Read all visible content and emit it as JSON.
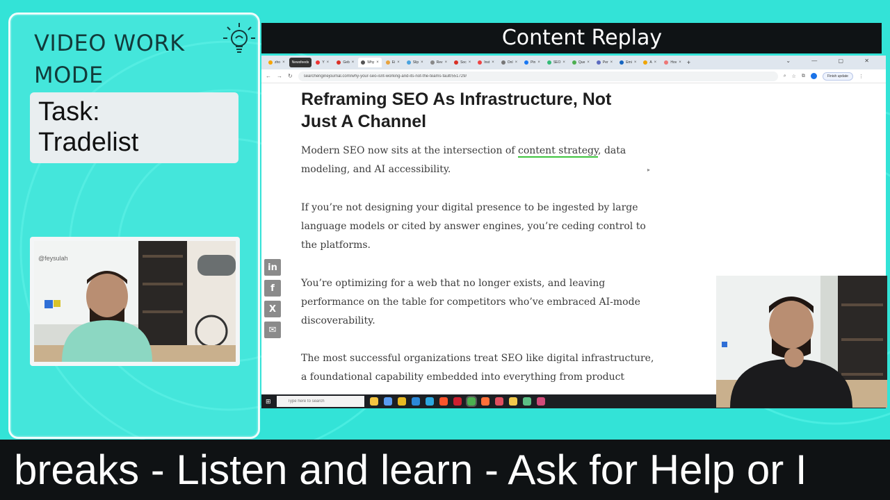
{
  "overlay": {
    "mode_title": "VIDEO WORK MODE",
    "task_label": "Task:",
    "task_value": "Tradelist",
    "header_title": "Content Replay",
    "ticker_text": "breaks - Listen and learn - Ask for Help or I"
  },
  "browser": {
    "tabs": [
      {
        "label": "zho",
        "active": false
      },
      {
        "label": "Newsfeeds",
        "active": false,
        "badge": true
      },
      {
        "label": "Y",
        "active": false
      },
      {
        "label": "Geb",
        "active": false
      },
      {
        "label": "Why",
        "active": true
      },
      {
        "label": "Ei",
        "active": false
      },
      {
        "label": "Slip",
        "active": false
      },
      {
        "label": "Rev",
        "active": false
      },
      {
        "label": "Soc",
        "active": false
      },
      {
        "label": "Inst",
        "active": false
      },
      {
        "label": "Onl",
        "active": false
      },
      {
        "label": "Pin",
        "active": false
      },
      {
        "label": "SEO",
        "active": false
      },
      {
        "label": "Que",
        "active": false
      },
      {
        "label": "Per",
        "active": false
      },
      {
        "label": "Emi",
        "active": false
      },
      {
        "label": "A",
        "active": false
      },
      {
        "label": "Hov",
        "active": false
      }
    ],
    "url": "searchenginejournal.com/why-your-seo-isnt-working-and-its-not-the-teams-fault/551729/",
    "update_label": "Finish update",
    "taskbar_search_placeholder": "Type here to search"
  },
  "article": {
    "title": "Reframing SEO As Infrastructure, Not Just A Channel",
    "p1_before": "Modern SEO now sits at the intersection of ",
    "p1_link": "content strategy",
    "p1_after": ", data modeling, and AI accessibility.",
    "p2": "If you’re not designing your digital presence to be ingested by large language models or cited by answer engines, you’re ceding control to the platforms.",
    "p3": "You’re optimizing for a web that no longer exists, and leaving performance on the table for competitors who’ve embraced AI-mode discoverability.",
    "p4": "The most successful organizations treat SEO like digital infrastructure, a foundational capability embedded into everything from product"
  },
  "share": {
    "linkedin": "in",
    "facebook": "f",
    "x": "X",
    "email": "✉"
  },
  "webcam": {
    "whiteboard_text": "@feysulah"
  },
  "colors": {
    "background": "#33e3d7",
    "dark_bar": "#0f1315",
    "link_underline": "#3dc43d"
  }
}
